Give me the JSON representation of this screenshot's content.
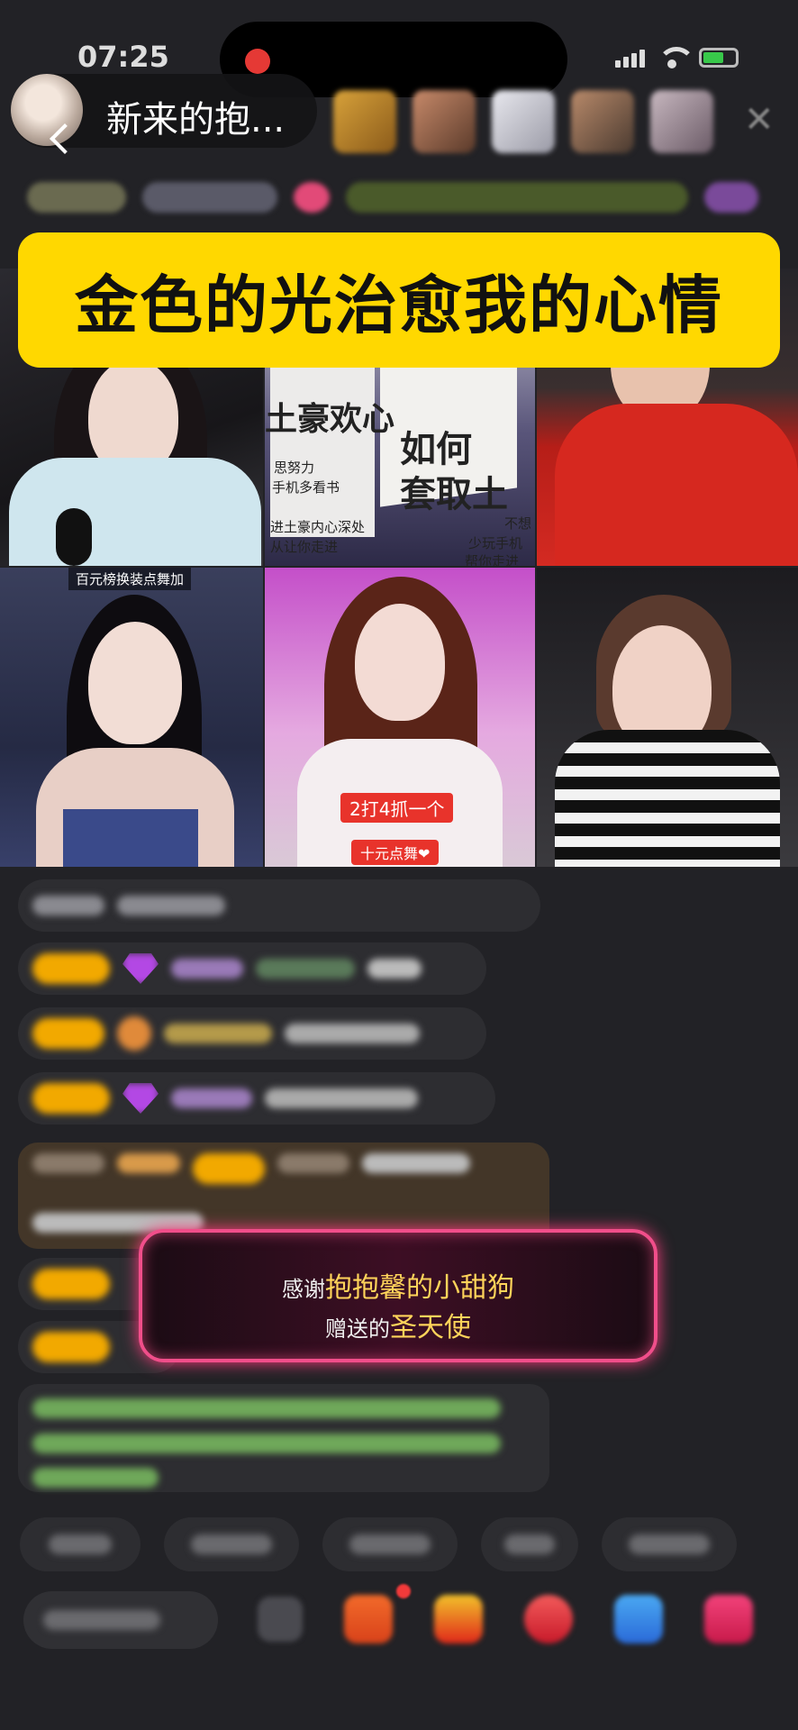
{
  "status_bar": {
    "time": "07:25",
    "battery_level": 0.5,
    "colors": {
      "recording_dot": "#e53935",
      "battery": "#38c84a"
    }
  },
  "header": {
    "host_name": "新来的抱...",
    "icons": [
      "back-icon",
      "close-icon"
    ]
  },
  "banner": {
    "text": "金色的光治愈我的心情",
    "color": "#ffd800"
  },
  "video_grid": {
    "cells": [
      {
        "id": "seat-1",
        "overlay": ""
      },
      {
        "id": "seat-2",
        "overlay": "",
        "book_title": "如何\n套取土",
        "book_side": "土豪欢心",
        "book_lines": [
          "思努力",
          "手机多看书",
          "进土豪内心深处",
          "从让你走进"
        ],
        "book_side_lines": [
          "不想",
          "少玩手机",
          "帮你走进"
        ]
      },
      {
        "id": "seat-3",
        "overlay": ""
      },
      {
        "id": "seat-4",
        "overlay": "百元榜换装点舞加"
      },
      {
        "id": "seat-5",
        "overlay": "2打4抓一个",
        "overlay2": "十元点舞❤"
      },
      {
        "id": "seat-6",
        "overlay": ""
      }
    ]
  },
  "gift_popup": {
    "prefix": "感谢",
    "sender": "抱抱馨的小甜狗",
    "gift_prefix": "赠送的",
    "gift": "圣天使",
    "border_color": "#f04e8a"
  },
  "accent_colors": {
    "badge": "#f2a900",
    "gem": "#b348e4",
    "chat_green": "#7fd36b"
  }
}
